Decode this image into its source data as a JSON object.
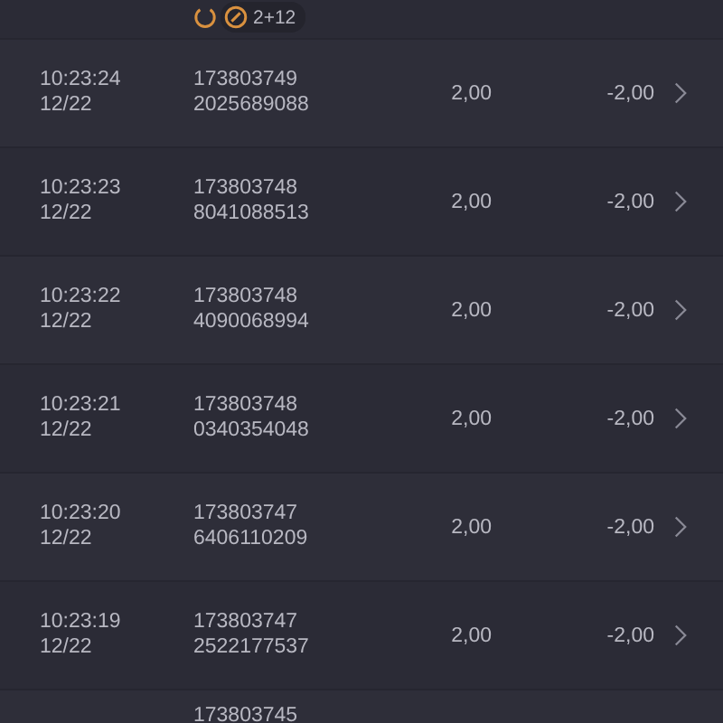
{
  "top_row": {
    "badge": "2+12"
  },
  "rows": [
    {
      "time": "10:23:24",
      "date": "12/22",
      "id_1": "173803749",
      "id_2": "2025689088",
      "stake": "2,00",
      "result": "-2,00"
    },
    {
      "time": "10:23:23",
      "date": "12/22",
      "id_1": "173803748",
      "id_2": "8041088513",
      "stake": "2,00",
      "result": "-2,00"
    },
    {
      "time": "10:23:22",
      "date": "12/22",
      "id_1": "173803748",
      "id_2": "4090068994",
      "stake": "2,00",
      "result": "-2,00"
    },
    {
      "time": "10:23:21",
      "date": "12/22",
      "id_1": "173803748",
      "id_2": "0340354048",
      "stake": "2,00",
      "result": "-2,00"
    },
    {
      "time": "10:23:20",
      "date": "12/22",
      "id_1": "173803747",
      "id_2": "6406110209",
      "stake": "2,00",
      "result": "-2,00"
    },
    {
      "time": "10:23:19",
      "date": "12/22",
      "id_1": "173803747",
      "id_2": "2522177537",
      "stake": "2,00",
      "result": "-2,00"
    }
  ],
  "partial_row": {
    "id_1": "173803745"
  }
}
